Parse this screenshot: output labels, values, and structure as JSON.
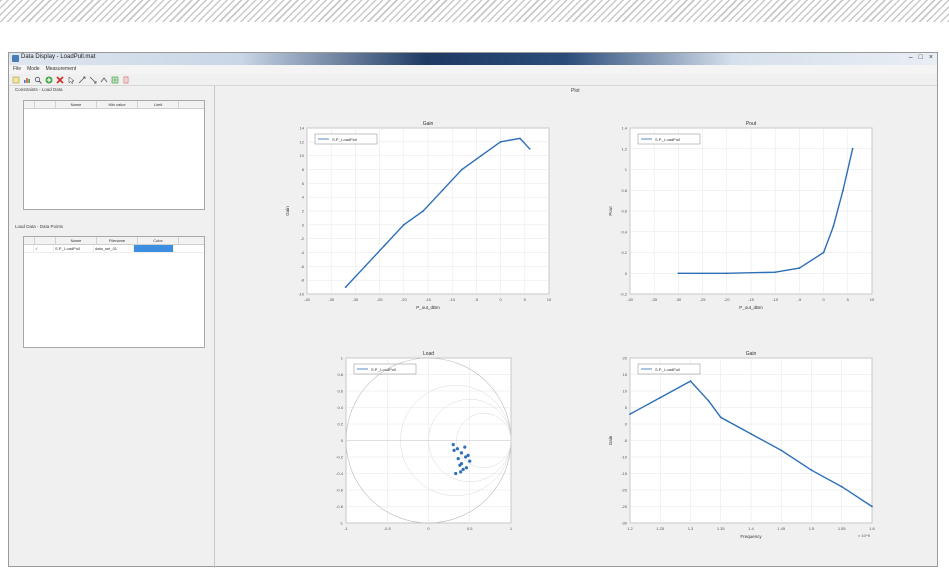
{
  "window": {
    "title": "Data Display - LoadPull.mat",
    "controls": [
      "–",
      "□",
      "×"
    ]
  },
  "menu": [
    "File",
    "Mode",
    "Measurement"
  ],
  "toolbar": {
    "icons": [
      "new-icon",
      "plot-icon",
      "zoom-icon",
      "add-icon",
      "delete-icon",
      "cursor-icon",
      "pan-icon",
      "zoom-in-icon",
      "zoom-out-icon",
      "grid-icon",
      "export-icon"
    ]
  },
  "top_panel": {
    "label": "Constraints - Load Data",
    "columns": [
      "",
      "Name",
      "Min value",
      "Limit"
    ]
  },
  "bottom_panel": {
    "label": "Load Data - Data Points",
    "columns": [
      "",
      "Name",
      "Filename",
      "Color"
    ],
    "rows": [
      {
        "check": "✓",
        "name": "S.P._LoadPull",
        "filename": "data_set_01",
        "color": ""
      }
    ]
  },
  "plots_header": "Plot",
  "charts": [
    {
      "title": "Gain",
      "type": "line",
      "xlabel": "P_out_dBm",
      "ylabel": "Gain",
      "legend": "S.P._LoadPull",
      "xticks": [
        "-40",
        "-35",
        "-30",
        "-25",
        "-20",
        "-15",
        "-10",
        "-5",
        "0",
        "5",
        "10"
      ],
      "yticks": [
        "-10",
        "-8",
        "-6",
        "-4",
        "-2",
        "0",
        "2",
        "4",
        "6",
        "8",
        "10",
        "12",
        "14"
      ],
      "xlim": [
        -40,
        10
      ],
      "ylim": [
        -10,
        14
      ]
    },
    {
      "title": "Pout",
      "type": "line",
      "xlabel": "P_out_dBm",
      "ylabel": "Pout",
      "legend": "S.P._LoadPull",
      "xticks": [
        "-40",
        "-35",
        "-30",
        "-25",
        "-20",
        "-15",
        "-10",
        "-5",
        "0",
        "5",
        "10"
      ],
      "yticks": [
        "-0.2",
        "0",
        "0.2",
        "0.4",
        "0.6",
        "0.8",
        "1",
        "1.2",
        "1.4"
      ],
      "xlim": [
        -40,
        10
      ],
      "ylim": [
        -0.2,
        1.4
      ]
    },
    {
      "title": "Load",
      "type": "scatter",
      "legend": "S.P._LoadPull",
      "xticks": [
        "-1",
        "-0.5",
        "0",
        "0.5",
        "1"
      ],
      "yticks": [
        "-1",
        "-0.8",
        "-0.6",
        "-0.4",
        "-0.2",
        "0",
        "0.2",
        "0.4",
        "0.6",
        "0.8",
        "1"
      ],
      "xlim": [
        -1,
        1
      ],
      "ylim": [
        -1,
        1
      ]
    },
    {
      "title": "Gain",
      "type": "line",
      "xlabel": "Frequency",
      "ylabel": "Gain",
      "legend": "S.P._LoadPull",
      "multiplier": "× 10^9",
      "xticks": [
        "1.2",
        "1.25",
        "1.3",
        "1.35",
        "1.4",
        "1.45",
        "1.5",
        "1.55",
        "1.6"
      ],
      "yticks": [
        "-30",
        "-25",
        "-20",
        "-15",
        "-10",
        "-5",
        "0",
        "5",
        "10",
        "15",
        "20"
      ],
      "xlim": [
        1.2,
        1.6
      ],
      "ylim": [
        -30,
        20
      ]
    }
  ],
  "chart_data": [
    {
      "type": "line",
      "title": "Gain",
      "xlabel": "P_out_dBm",
      "ylabel": "Gain",
      "xlim": [
        -40,
        10
      ],
      "ylim": [
        -10,
        14
      ],
      "grid": true,
      "legend_placement": "top-left",
      "series": [
        {
          "name": "S.P._LoadPull",
          "x": [
            -32,
            -28,
            -24,
            -20,
            -16,
            -12,
            -8,
            -4,
            0,
            4,
            6
          ],
          "y": [
            -9,
            -6,
            -3,
            0,
            2,
            5,
            8,
            10,
            12,
            12.5,
            11
          ]
        }
      ]
    },
    {
      "type": "line",
      "title": "Pout",
      "xlabel": "P_out_dBm",
      "ylabel": "Pout",
      "xlim": [
        -40,
        10
      ],
      "ylim": [
        -0.2,
        1.4
      ],
      "grid": true,
      "legend_placement": "top-left",
      "series": [
        {
          "name": "S.P._LoadPull",
          "x": [
            -30,
            -20,
            -10,
            -5,
            0,
            2,
            4,
            6
          ],
          "y": [
            0,
            0,
            0.01,
            0.05,
            0.2,
            0.45,
            0.8,
            1.2
          ]
        }
      ]
    },
    {
      "type": "scatter",
      "title": "Load",
      "xlim": [
        -1,
        1
      ],
      "ylim": [
        -1,
        1
      ],
      "grid": true,
      "legend_placement": "top-left",
      "series": [
        {
          "name": "S.P._LoadPull",
          "x": [
            0.3,
            0.35,
            0.4,
            0.45,
            0.5,
            0.38,
            0.42,
            0.33,
            0.48,
            0.36,
            0.44,
            0.4,
            0.31,
            0.46,
            0.39
          ],
          "y": [
            -0.05,
            -0.1,
            -0.15,
            -0.2,
            -0.25,
            -0.3,
            -0.35,
            -0.4,
            -0.18,
            -0.22,
            -0.08,
            -0.28,
            -0.12,
            -0.33,
            -0.38
          ]
        }
      ]
    },
    {
      "type": "line",
      "title": "Gain",
      "xlabel": "Frequency",
      "ylabel": "Gain",
      "xlim": [
        1.2,
        1.6
      ],
      "ylim": [
        -30,
        20
      ],
      "grid": true,
      "legend_placement": "top-left",
      "series": [
        {
          "name": "S.P._LoadPull",
          "x": [
            1.2,
            1.25,
            1.3,
            1.33,
            1.35,
            1.4,
            1.45,
            1.5,
            1.55,
            1.6
          ],
          "y": [
            3,
            8,
            13,
            7,
            2,
            -3,
            -8,
            -14,
            -19,
            -25
          ]
        }
      ]
    }
  ]
}
